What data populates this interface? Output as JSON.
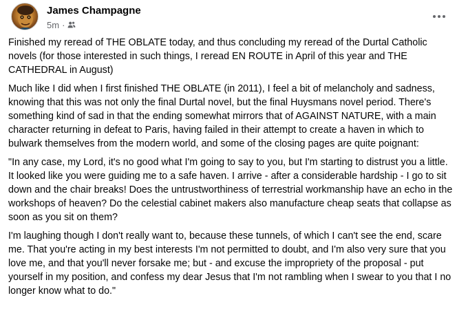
{
  "post": {
    "author": "James Champagne",
    "time": "5m",
    "audience_icon": "friends-icon",
    "more_icon": "more-options-icon",
    "paragraphs": [
      "Finished my reread of THE OBLATE today, and thus concluding my reread of the Durtal Catholic novels (for those interested in such things, I reread EN ROUTE in April of this year and THE CATHEDRAL in August)",
      "Much like I did when I first finished THE OBLATE (in 2011), I feel a bit of melancholy and sadness, knowing that this was not only the final Durtal novel, but the final Huysmans novel period. There's something kind of sad in that the ending somewhat mirrors that of AGAINST NATURE, with a main character returning in defeat to Paris, having failed in their attempt to create a haven in which to bulwark themselves from the modern world, and some of the closing pages are quite poignant:",
      "\"In any case, my Lord, it's no good what I'm going to say to you, but I'm starting to distrust you a little. It looked like you were guiding me to a safe haven. I arrive - after a considerable hardship - I go to sit down and the chair breaks! Does the untrustworthiness of terrestrial workmanship have an echo in the workshops of heaven? Do the celestial cabinet makers also manufacture cheap seats that collapse as soon as you sit on them?",
      "I'm laughing though I don't really want to, because these tunnels, of which I can't see the end, scare me. That you're acting in my best interests I'm not permitted to doubt, and I'm also very sure that you love me, and that you'll never forsake me; but - and excuse the impropriety of the proposal - put yourself in my position, and confess my dear Jesus that I'm not rambling when I swear to you that I no longer know what to do.\""
    ]
  }
}
